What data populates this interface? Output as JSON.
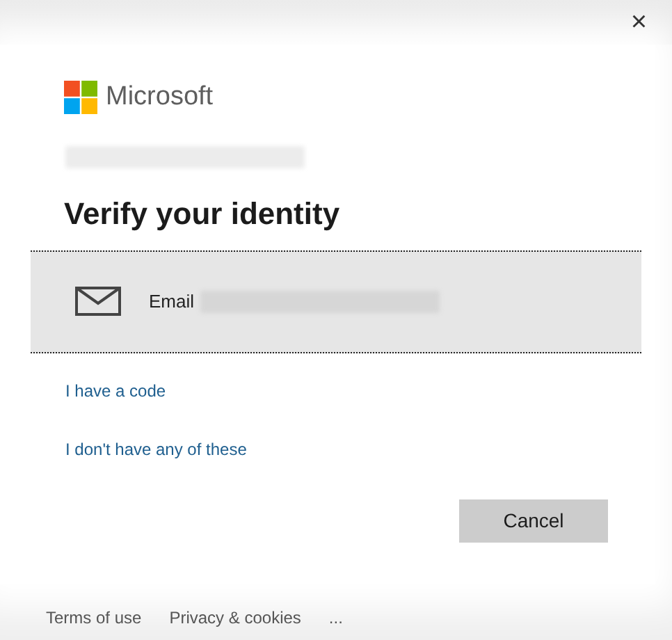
{
  "window": {
    "close": "×"
  },
  "brand": {
    "name": "Microsoft"
  },
  "account": {
    "redacted": true
  },
  "title": "Verify your identity",
  "options": [
    {
      "kind": "email",
      "label": "Email",
      "redacted": true,
      "selected": true
    }
  ],
  "links": [
    "I have a code",
    "I don't have any of these"
  ],
  "buttons": [
    "Cancel"
  ],
  "footer": [
    "Terms of use",
    "Privacy & cookies",
    "..."
  ]
}
